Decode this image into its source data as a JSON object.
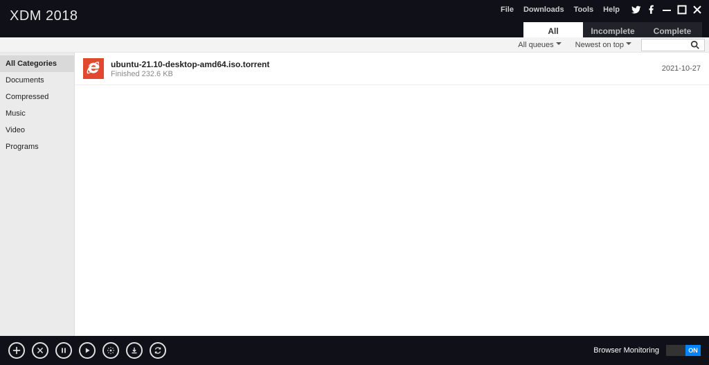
{
  "app_title": "XDM 2018",
  "menu": {
    "file": "File",
    "downloads": "Downloads",
    "tools": "Tools",
    "help": "Help"
  },
  "tabs": {
    "all": "All",
    "incomplete": "Incomplete",
    "complete": "Complete",
    "active": "all"
  },
  "filters": {
    "queue": "All queues",
    "sort": "Newest on top",
    "search_placeholder": ""
  },
  "sidebar": {
    "items": [
      {
        "label": "All Categories",
        "selected": true
      },
      {
        "label": "Documents"
      },
      {
        "label": "Compressed"
      },
      {
        "label": "Music"
      },
      {
        "label": "Video"
      },
      {
        "label": "Programs"
      }
    ]
  },
  "downloads": [
    {
      "name": "ubuntu-21.10-desktop-amd64.iso.torrent",
      "status": "Finished 232.6 KB",
      "date": "2021-10-27",
      "icon": "ie-icon"
    }
  ],
  "footer": {
    "monitor_label": "Browser Monitoring",
    "toggle_on": "ON"
  }
}
